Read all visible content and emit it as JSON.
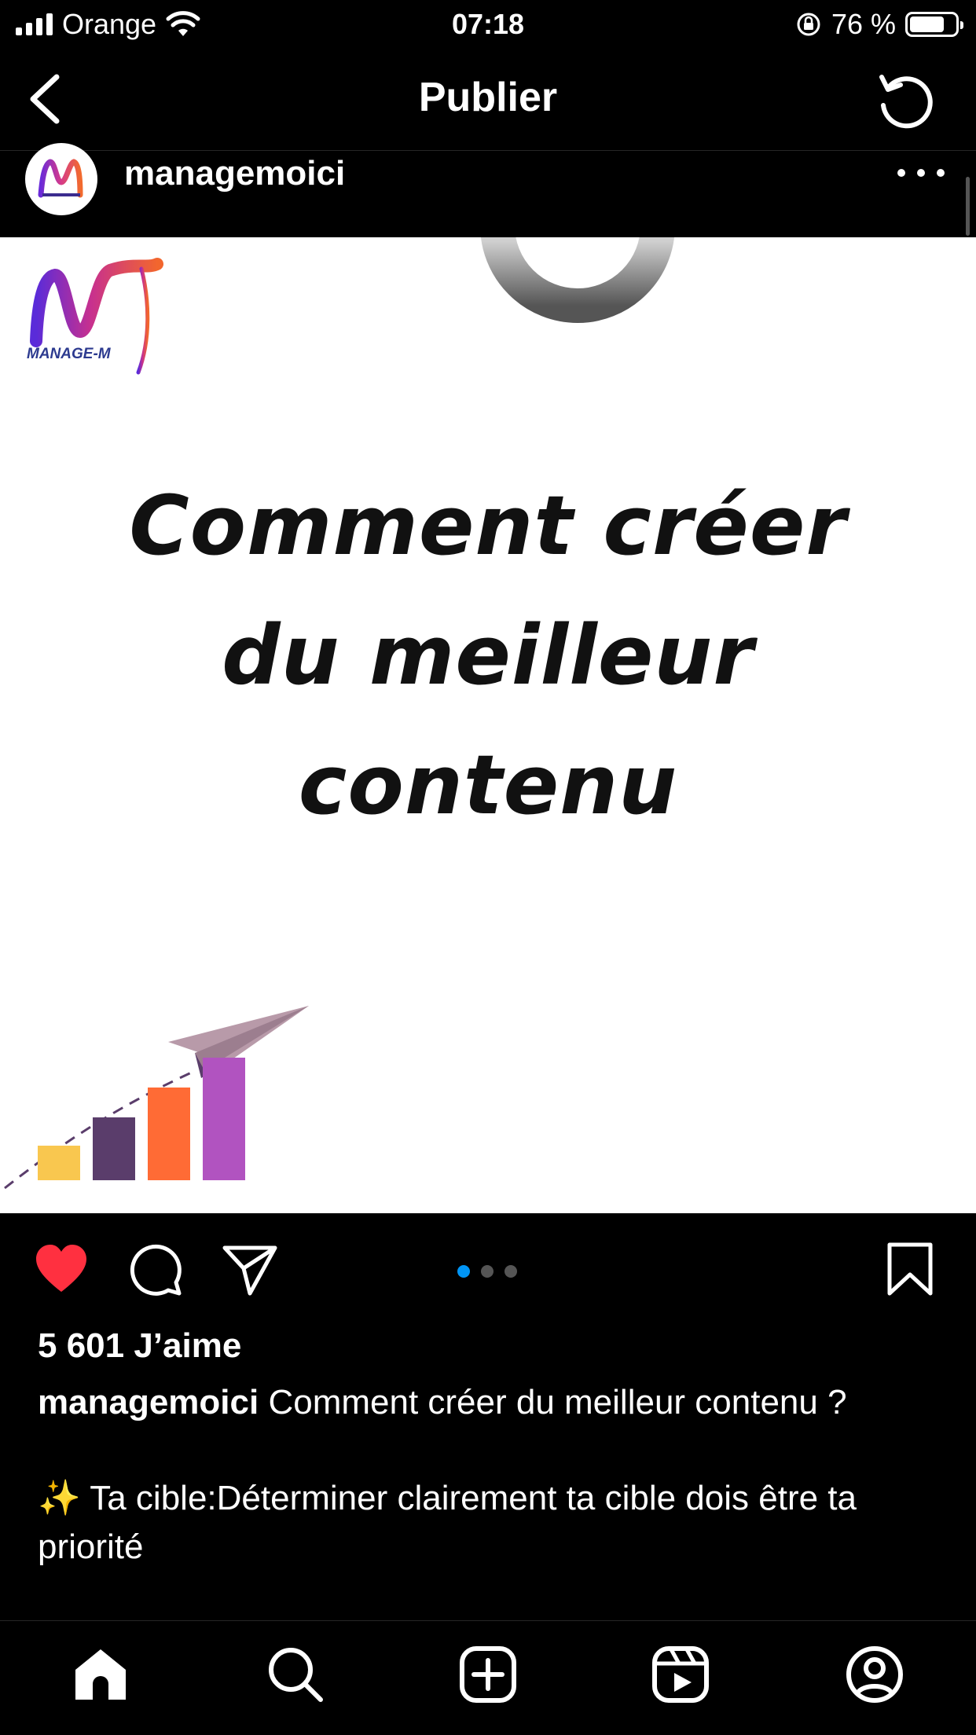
{
  "status_bar": {
    "carrier": "Orange",
    "time": "07:18",
    "battery": "76 %",
    "battery_level": 0.76
  },
  "header": {
    "title": "Publier"
  },
  "post": {
    "username": "managemoici",
    "logo_text": "MANAGE-M   I",
    "headline_lines": [
      "Comment créer",
      "du meilleur",
      "contenu"
    ],
    "carousel": {
      "count": 3,
      "active_index": 0
    },
    "likes": "5 601 J’aime",
    "caption_user": "managemoici",
    "caption_text": "Comment créer du meilleur contenu ?",
    "caption_emoji": "✨",
    "caption_body": "Ta cible:Déterminer clairement ta cible dois être ta priorité"
  },
  "icons": {
    "header": [
      "back-icon",
      "refresh-icon"
    ],
    "actions": [
      "heart-icon",
      "comment-icon",
      "share-icon",
      "bookmark-icon"
    ],
    "tabbar": [
      "home-icon",
      "search-icon",
      "create-icon",
      "reels-icon",
      "profile-icon"
    ]
  },
  "colors": {
    "like": "#ff3040",
    "carousel_active": "#0095f6",
    "background": "#000000",
    "chart_bars": [
      "#f9c74f",
      "#5a3d6b",
      "#ff6b35",
      "#b153c0"
    ],
    "plane": "#b89aa9"
  }
}
